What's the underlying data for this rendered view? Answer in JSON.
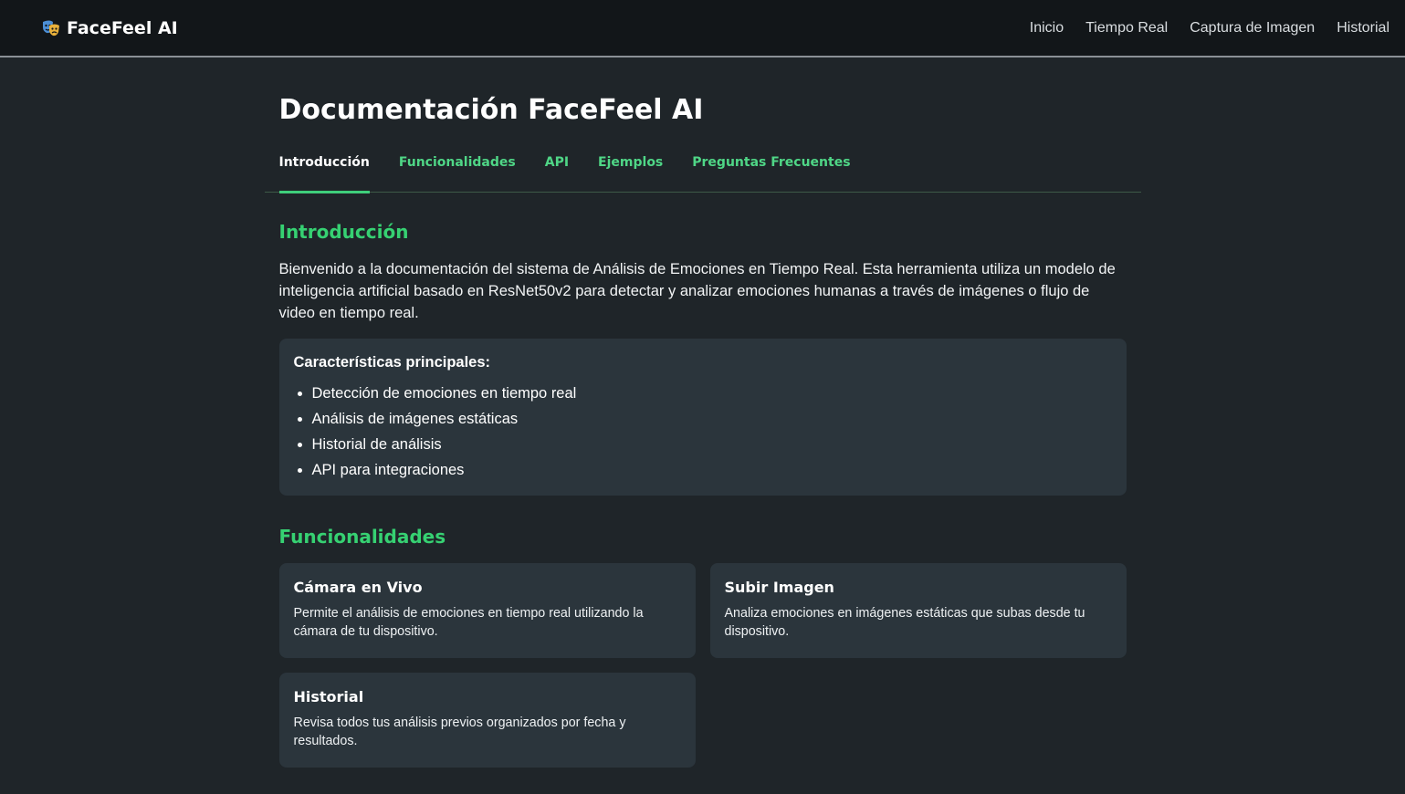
{
  "navbar": {
    "brand": "FaceFeel AI",
    "brand_icon": "theater-masks-icon",
    "links": [
      "Inicio",
      "Tiempo Real",
      "Captura de Imagen",
      "Historial"
    ]
  },
  "page": {
    "title": "Documentación FaceFeel AI",
    "tabs": [
      "Introducción",
      "Funcionalidades",
      "API",
      "Ejemplos",
      "Preguntas Frecuentes"
    ],
    "active_tab": "Introducción"
  },
  "intro": {
    "title": "Introducción",
    "text": "Bienvenido a la documentación del sistema de Análisis de Emociones en Tiempo Real. Esta herramienta utiliza un modelo de inteligencia artificial basado en ResNet50v2 para detectar y analizar emociones humanas a través de imágenes o flujo de video en tiempo real.",
    "features_title": "Características principales:",
    "features": [
      "Detección de emociones en tiempo real",
      "Análisis de imágenes estáticas",
      "Historial de análisis",
      "API para integraciones"
    ]
  },
  "functionalities": {
    "title": "Funcionalidades",
    "cards": [
      {
        "title": "Cámara en Vivo",
        "text": "Permite el análisis de emociones en tiempo real utilizando la cámara de tu dispositivo."
      },
      {
        "title": "Subir Imagen",
        "text": "Analiza emociones en imágenes estáticas que subas desde tu dispositivo."
      },
      {
        "title": "Historial",
        "text": "Revisa todos tus análisis previos organizados por fecha y resultados."
      }
    ]
  },
  "colors": {
    "accent": "#36d172",
    "background": "#1f2529",
    "navbar": "#121619",
    "card": "#2b353c"
  }
}
